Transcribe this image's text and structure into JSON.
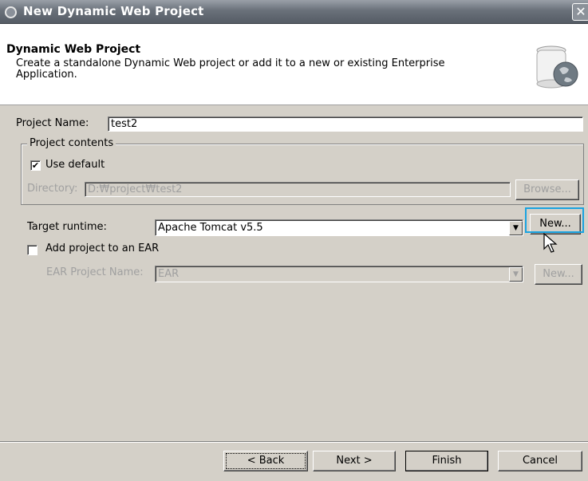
{
  "window": {
    "title": "New Dynamic Web Project",
    "close_glyph": "✕"
  },
  "header": {
    "title": "Dynamic Web Project",
    "description": "Create a standalone Dynamic Web project or add it to a new or existing Enterprise Application.",
    "icon": "globe-jar-icon"
  },
  "project_name": {
    "label": "Project Name:",
    "value": "test2"
  },
  "project_contents": {
    "legend": "Project contents",
    "use_default_label": "Use default",
    "use_default_checked": true,
    "directory_label": "Directory:",
    "directory_value": "D:₩project₩test2",
    "browse_label": "Browse..."
  },
  "target_runtime": {
    "label": "Target runtime:",
    "value": "Apache Tomcat v5.5",
    "new_label": "New..."
  },
  "ear": {
    "add_label": "Add project to an EAR",
    "add_checked": false,
    "name_label": "EAR Project Name:",
    "name_value": "EAR",
    "new_label": "New..."
  },
  "footer": {
    "back_label": "< Back",
    "next_label": "Next >",
    "finish_label": "Finish",
    "cancel_label": "Cancel"
  },
  "colors": {
    "highlight": "#1aa3e0",
    "dialog_bg": "#d4d0c8"
  }
}
